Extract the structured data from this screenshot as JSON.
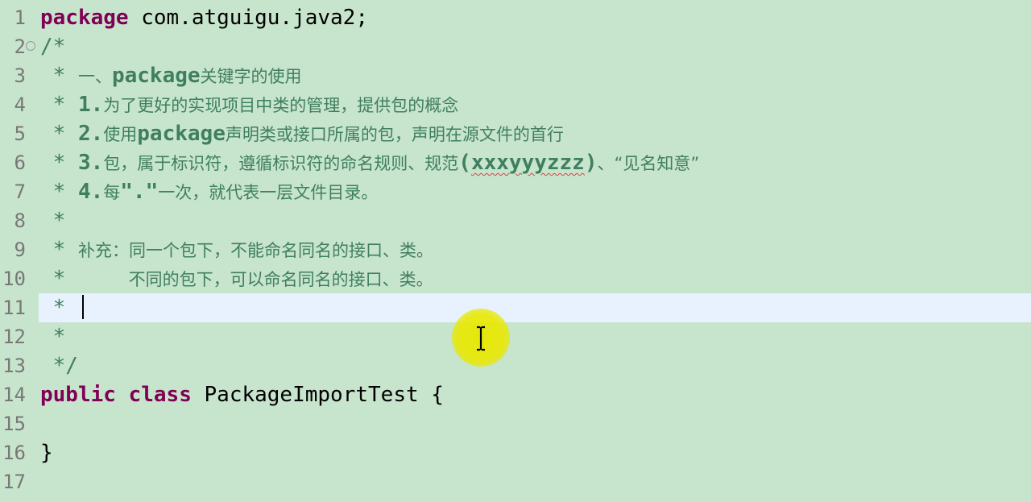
{
  "editor": {
    "language": "java",
    "lines": [
      {
        "num": "1",
        "parts": [
          {
            "t": "kw",
            "v": "package"
          },
          {
            "t": "pl",
            "v": " com.atguigu.java2;"
          }
        ]
      },
      {
        "num": "2",
        "fold": "⊖",
        "parts": [
          {
            "t": "cm",
            "v": "/*"
          }
        ]
      },
      {
        "num": "3",
        "parts": [
          {
            "t": "cm",
            "v": " * "
          },
          {
            "t": "cjk",
            "v": "一、"
          },
          {
            "t": "mono",
            "v": "package"
          },
          {
            "t": "cjk",
            "v": "关键字的使用"
          }
        ]
      },
      {
        "num": "4",
        "parts": [
          {
            "t": "cm",
            "v": " * "
          },
          {
            "t": "mono",
            "v": "1."
          },
          {
            "t": "cjk",
            "v": "为了更好的实现项目中类的管理，提供包的概念"
          }
        ]
      },
      {
        "num": "5",
        "parts": [
          {
            "t": "cm",
            "v": " * "
          },
          {
            "t": "mono",
            "v": "2."
          },
          {
            "t": "cjk",
            "v": "使用"
          },
          {
            "t": "mono",
            "v": "package"
          },
          {
            "t": "cjk",
            "v": "声明类或接口所属的包，声明在源文件的首行"
          }
        ]
      },
      {
        "num": "6",
        "parts": [
          {
            "t": "cm",
            "v": " * "
          },
          {
            "t": "mono",
            "v": "3."
          },
          {
            "t": "cjk",
            "v": "包，属于标识符，遵循标识符的命名规则、规范"
          },
          {
            "t": "mono",
            "v": "("
          },
          {
            "t": "squig",
            "v": "xxxyyyzzz"
          },
          {
            "t": "mono",
            "v": ")"
          },
          {
            "t": "cjk",
            "v": "、“见名知意”"
          }
        ]
      },
      {
        "num": "7",
        "parts": [
          {
            "t": "cm",
            "v": " * "
          },
          {
            "t": "mono",
            "v": "4."
          },
          {
            "t": "cjk",
            "v": "每"
          },
          {
            "t": "mono",
            "v": "\".\""
          },
          {
            "t": "cjk",
            "v": "一次，就代表一层文件目录。"
          }
        ]
      },
      {
        "num": "8",
        "parts": [
          {
            "t": "cm",
            "v": " *"
          }
        ]
      },
      {
        "num": "9",
        "parts": [
          {
            "t": "cm",
            "v": " * "
          },
          {
            "t": "cjk",
            "v": "补充：同一个包下，不能命名同名的接口、类。"
          }
        ]
      },
      {
        "num": "10",
        "parts": [
          {
            "t": "cm",
            "v": " *     "
          },
          {
            "t": "cjk",
            "v": "不同的包下，可以命名同名的接口、类。"
          }
        ]
      },
      {
        "num": "11",
        "current": true,
        "parts": [
          {
            "t": "cm",
            "v": " * "
          }
        ]
      },
      {
        "num": "12",
        "parts": [
          {
            "t": "cm",
            "v": " *"
          }
        ]
      },
      {
        "num": "13",
        "parts": [
          {
            "t": "cm",
            "v": " */"
          }
        ]
      },
      {
        "num": "14",
        "parts": [
          {
            "t": "kw",
            "v": "public"
          },
          {
            "t": "pl",
            "v": " "
          },
          {
            "t": "kw",
            "v": "class"
          },
          {
            "t": "pl",
            "v": " PackageImportTest {"
          }
        ]
      },
      {
        "num": "15",
        "parts": []
      },
      {
        "num": "16",
        "parts": [
          {
            "t": "pl",
            "v": "}"
          }
        ]
      },
      {
        "num": "17",
        "parts": []
      }
    ]
  },
  "colors": {
    "background": "#c7e4cd",
    "keyword": "#7f0055",
    "comment": "#3f7f5f",
    "current_line": "#e8f2fe",
    "cursor_highlight": "#e8e800"
  },
  "cursor": {
    "icon": "ibeam-cursor-icon"
  }
}
